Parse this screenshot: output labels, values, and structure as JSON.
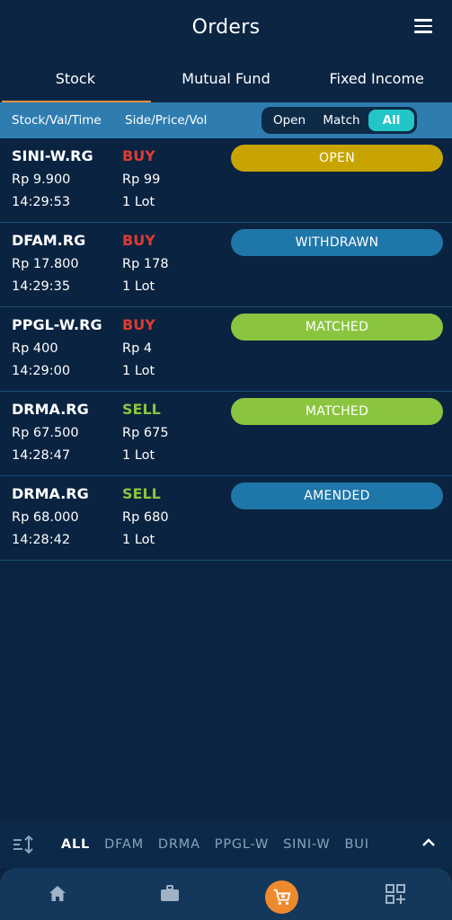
{
  "header": {
    "title": "Orders",
    "menu_icon": "hamburger-menu-icon"
  },
  "tabs": [
    {
      "label": "Stock",
      "active": true
    },
    {
      "label": "Mutual Fund",
      "active": false
    },
    {
      "label": "Fixed Income",
      "active": false
    }
  ],
  "filterbar": {
    "col1_header": "Stock/Val/Time",
    "col2_header": "Side/Price/Vol",
    "segments": [
      {
        "label": "Open",
        "selected": false
      },
      {
        "label": "Match",
        "selected": false
      },
      {
        "label": "All",
        "selected": true
      }
    ]
  },
  "orders": [
    {
      "symbol": "SINI-W.RG",
      "value": "Rp 9.900",
      "time": "14:29:53",
      "side": "BUY",
      "price": "Rp 99",
      "volume": "1 Lot",
      "status": "OPEN",
      "status_color": "#c8a400"
    },
    {
      "symbol": "DFAM.RG",
      "value": "Rp 17.800",
      "time": "14:29:35",
      "side": "BUY",
      "price": "Rp 178",
      "volume": "1 Lot",
      "status": "WITHDRAWN",
      "status_color": "#1f76a8"
    },
    {
      "symbol": "PPGL-W.RG",
      "value": "Rp 400",
      "time": "14:29:00",
      "side": "BUY",
      "price": "Rp 4",
      "volume": "1 Lot",
      "status": "MATCHED",
      "status_color": "#8bc53f"
    },
    {
      "symbol": "DRMA.RG",
      "value": "Rp 67.500",
      "time": "14:28:47",
      "side": "SELL",
      "price": "Rp 675",
      "volume": "1 Lot",
      "status": "MATCHED",
      "status_color": "#8bc53f"
    },
    {
      "symbol": "DRMA.RG",
      "value": "Rp 68.000",
      "time": "14:28:42",
      "side": "SELL",
      "price": "Rp 680",
      "volume": "1 Lot",
      "status": "AMENDED",
      "status_color": "#1f76a8"
    }
  ],
  "ticker": {
    "sort_icon": "sort-icon",
    "items": [
      "ALL",
      "DFAM",
      "DRMA",
      "PPGL-W",
      "SINI-W",
      "BUI"
    ],
    "active": "ALL",
    "expand_icon": "chevron-up-icon"
  },
  "bottom_nav": [
    {
      "icon": "home-icon",
      "active": false
    },
    {
      "icon": "briefcase-icon",
      "active": false
    },
    {
      "icon": "cart-icon",
      "active": true
    },
    {
      "icon": "qr-add-icon",
      "active": false
    }
  ],
  "colors": {
    "background": "#0b2441",
    "accent": "#e8903a",
    "filter_bar": "#2f7db0",
    "buy": "#e23a32",
    "sell": "#8bc53f"
  }
}
